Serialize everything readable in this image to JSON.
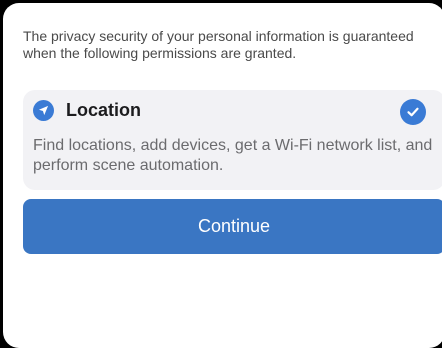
{
  "intro": {
    "text": "The privacy security of your personal information is guaranteed when the following permissions are granted."
  },
  "permission": {
    "icon": "location-arrow-icon",
    "title": "Location",
    "description": "Find locations, add devices, get a Wi-Fi network list, and perform scene automation.",
    "selected": true,
    "check_icon": "checkmark-icon"
  },
  "actions": {
    "continue_label": "Continue"
  },
  "colors": {
    "accent": "#3a7bd5",
    "button": "#3a76c3",
    "card_bg": "#f2f2f5"
  }
}
